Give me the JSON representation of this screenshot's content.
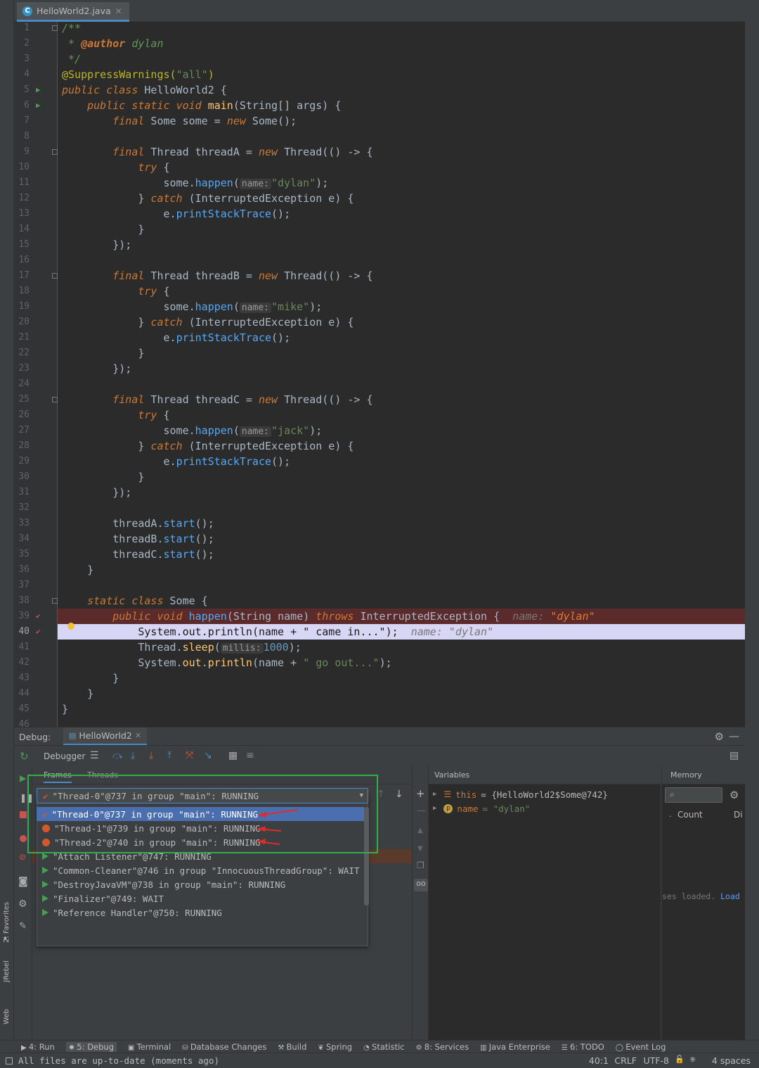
{
  "tab": {
    "filename": "HelloWorld2.java"
  },
  "code": {
    "l1": "/**",
    "l2a": " * ",
    "l2b": "@author",
    "l2c": " dylan",
    "l3": " */",
    "l4a": "@SuppressWarnings(",
    "l4b": "\"all\"",
    "l4c": ")",
    "public": "public",
    "class": "class",
    "static": "static",
    "void": "void",
    "final": "final",
    "new": "new",
    "try": "try",
    "catch": "catch",
    "throws": "throws",
    "HelloWorld2": "HelloWorld2",
    "main": "main",
    "mainArgs": "(String[] args) {",
    "someDecl": " Some some = ",
    "someNew": " Some();",
    "threadDecl": " Thread ",
    "threadNew": " Thread(() -> {",
    "tA": "threadA = ",
    "tB": "threadB = ",
    "tC": "threadC = ",
    "someHappen": "some.",
    "happen": "happen",
    "paren": "(",
    "hintName": "name:",
    "dylan": "\"dylan\"",
    "mike": "\"mike\"",
    "jack": "\"jack\"",
    "closeSemi": ");",
    "catchRest": " (InterruptedException e) {",
    "eDot": "e.",
    "printStackTrace": "printStackTrace",
    "emptyCall": "();",
    "closeBrace": "}",
    "tryBrace": " {",
    "closeLambda": "});",
    "startA": "threadA.",
    "startB": "threadB.",
    "startC": "threadC.",
    "start": "start",
    "classSome": " Some {",
    "happenSig": "(String ",
    "nameParam": "name",
    "happenSig2": ") ",
    "ie": " InterruptedException {",
    "inlineName": "name:",
    "inlineDylan": "\"dylan\"",
    "sysout1a": "System.",
    "out": "out",
    "println": "println",
    "sysout1b": "(name + ",
    "came": "\" came in...\"",
    "sysout1c": ");",
    "sleepA": "Thread.",
    "sleep": "sleep",
    "hintMillis": "millis:",
    "n1000": "1000",
    "sleepC": ");",
    "goout": "\" go out...\"",
    "openBrace": " {"
  },
  "debug": {
    "title": "Debug:",
    "session": "HelloWorld2",
    "debugger_tab": "Debugger",
    "frames_tab": "Frames",
    "threads_tab": "Threads",
    "selected_thread": "\"Thread-0\"@737 in group \"main\": RUNNING",
    "threads": [
      "\"Thread-0\"@737 in group \"main\": RUNNING",
      "\"Thread-1\"@739 in group \"main\": RUNNING",
      "\"Thread-2\"@740 in group \"main\": RUNNING",
      "\"Attach Listener\"@747: RUNNING",
      "\"Common-Cleaner\"@746 in group \"InnocuousThreadGroup\": WAIT",
      "\"DestroyJavaVM\"@738 in group \"main\": RUNNING",
      "\"Finalizer\"@749: WAIT",
      "\"Reference Handler\"@750: RUNNING"
    ],
    "variables_title": "Variables",
    "var_this_name": "this",
    "var_this_value": "= {HelloWorld2$Some@742}",
    "var_name_name": "name",
    "var_name_value": "= \"dylan\"",
    "memory_title": "Memory",
    "count_col": "Count",
    "diff_col": "Di",
    "classes_loaded": "ses loaded.",
    "load_link": "Load c"
  },
  "side": {
    "favorites": "2: Favorites",
    "jrebel": "JRebel",
    "web": "Web"
  },
  "bottom_tools": [
    "4: Run",
    "5: Debug",
    "Terminal",
    "Database Changes",
    "Build",
    "Spring",
    "Statistic",
    "8: Services",
    "Java Enterprise",
    "6: TODO",
    "Event Log"
  ],
  "status": {
    "message": "All files are up-to-date (moments ago)",
    "position": "40:1",
    "crlf": "CRLF",
    "encoding": "UTF-8",
    "indent": "4 spaces"
  },
  "colors": {
    "accent": "#4a88c7",
    "breakpoint": "#d05a2b",
    "highlight_box": "#2fae4a",
    "arrow": "#e02b2b"
  }
}
